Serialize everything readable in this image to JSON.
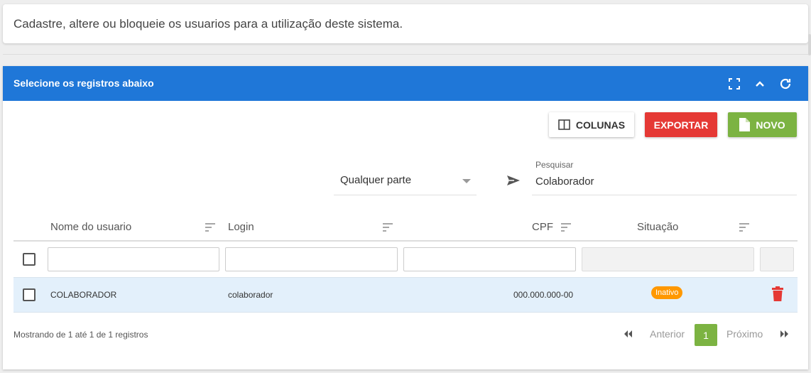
{
  "info": {
    "text": "Cadastre, altere ou bloqueie os usuarios para a utilização deste sistema."
  },
  "panel": {
    "title": "Selecione os registros abaixo",
    "header_icons": [
      "fullscreen-icon",
      "collapse-icon",
      "refresh-icon"
    ]
  },
  "toolbar": {
    "columns_label": "COLUNAS",
    "export_label": "EXPORTAR",
    "new_label": "NOVO"
  },
  "search": {
    "mode_value": "Qualquer parte",
    "label": "Pesquisar",
    "value": "Colaborador"
  },
  "table": {
    "columns": [
      "Nome do usuario",
      "Login",
      "CPF",
      "Situação"
    ],
    "rows": [
      {
        "name": "COLABORADOR",
        "login": "colaborador",
        "cpf": "000.000.000-00",
        "status": "Inativo"
      }
    ]
  },
  "pagination": {
    "summary": "Mostrando de 1 até 1 de 1 registros",
    "prev_label": "Anterior",
    "current_page": "1",
    "next_label": "Próximo"
  },
  "colors": {
    "header_blue": "#1f77d8",
    "export_red": "#e53935",
    "new_green": "#7cb342",
    "badge_orange": "#ff9800",
    "trash_red": "#e53935",
    "row_highlight": "#e3f0fb"
  }
}
